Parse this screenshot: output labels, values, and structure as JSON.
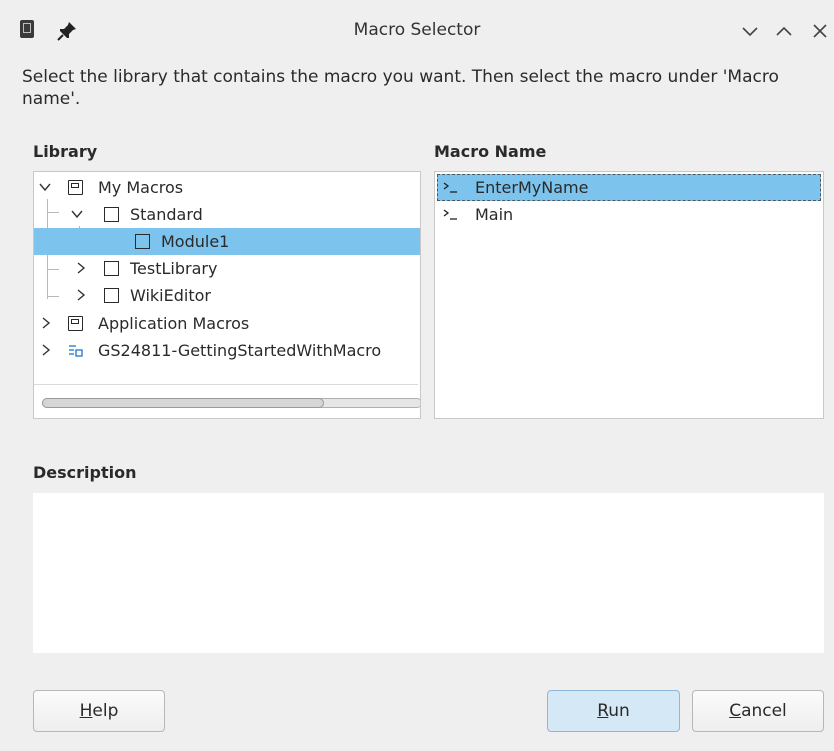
{
  "window": {
    "title": "Macro Selector",
    "icons": [
      "app-icon",
      "pin-icon",
      "minimize-icon",
      "maximize-icon",
      "close-icon"
    ]
  },
  "instructions": "Select the library that contains the macro you want. Then select the macro under 'Macro name'.",
  "library": {
    "label": "Library",
    "items": [
      {
        "label": "My Macros",
        "icon": "library-icon",
        "expanded": true,
        "selected": false
      },
      {
        "label": "Standard",
        "icon": "module-container-icon",
        "expanded": true,
        "selected": false
      },
      {
        "label": "Module1",
        "icon": "module-icon",
        "selected": true
      },
      {
        "label": "TestLibrary",
        "icon": "module-container-icon",
        "expanded": false,
        "selected": false
      },
      {
        "label": "WikiEditor",
        "icon": "module-container-icon",
        "expanded": false,
        "selected": false
      },
      {
        "label": "Application Macros",
        "icon": "library-icon",
        "expanded": false,
        "selected": false
      },
      {
        "label": "GS24811-GettingStartedWithMacro",
        "icon": "document-icon",
        "expanded": false,
        "selected": false
      }
    ],
    "horizontal_scroll_position": 0
  },
  "macros": {
    "label": "Macro Name",
    "items": [
      {
        "label": "EnterMyName",
        "icon": "macro-icon",
        "selected": true
      },
      {
        "label": "Main",
        "icon": "macro-icon",
        "selected": false
      }
    ]
  },
  "description": {
    "label": "Description",
    "text": ""
  },
  "buttons": {
    "help": {
      "mnemonic": "H",
      "rest": "elp"
    },
    "run": {
      "mnemonic": "R",
      "rest": "un"
    },
    "cancel": {
      "mnemonic": "C",
      "rest": "ancel"
    }
  },
  "colors": {
    "selection": "#7cc4ee",
    "primary_button": "#d4e8f6",
    "document_icon": "#2a7fd4"
  }
}
